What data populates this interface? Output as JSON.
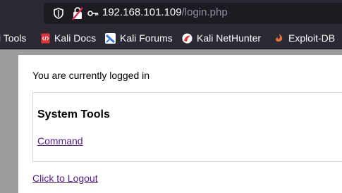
{
  "browser": {
    "url_host": "192.168.101.109",
    "url_path": "/login.php"
  },
  "bookmarks": [
    {
      "label": "i Tools",
      "icon": "none"
    },
    {
      "label": "Kali Docs",
      "icon": "kali-docs-icon",
      "color": "#e0343b"
    },
    {
      "label": "Kali Forums",
      "icon": "kali-forums-icon",
      "color": "#3d7dd8"
    },
    {
      "label": "Kali NetHunter",
      "icon": "kali-nethunter-icon",
      "color": "#e0343b"
    },
    {
      "label": "Exploit-DB",
      "icon": "exploit-db-icon",
      "color": "#e8713b"
    }
  ],
  "page": {
    "status": "You are currently logged in",
    "tools_title": "System Tools",
    "command_link": "Command",
    "logout_link": "Click to Logout"
  },
  "colors": {
    "chrome_bg": "#2b2a33",
    "url_field_bg": "#1c1b22",
    "page_bg": "#9b9b9b",
    "link_visited": "#551a8b"
  }
}
